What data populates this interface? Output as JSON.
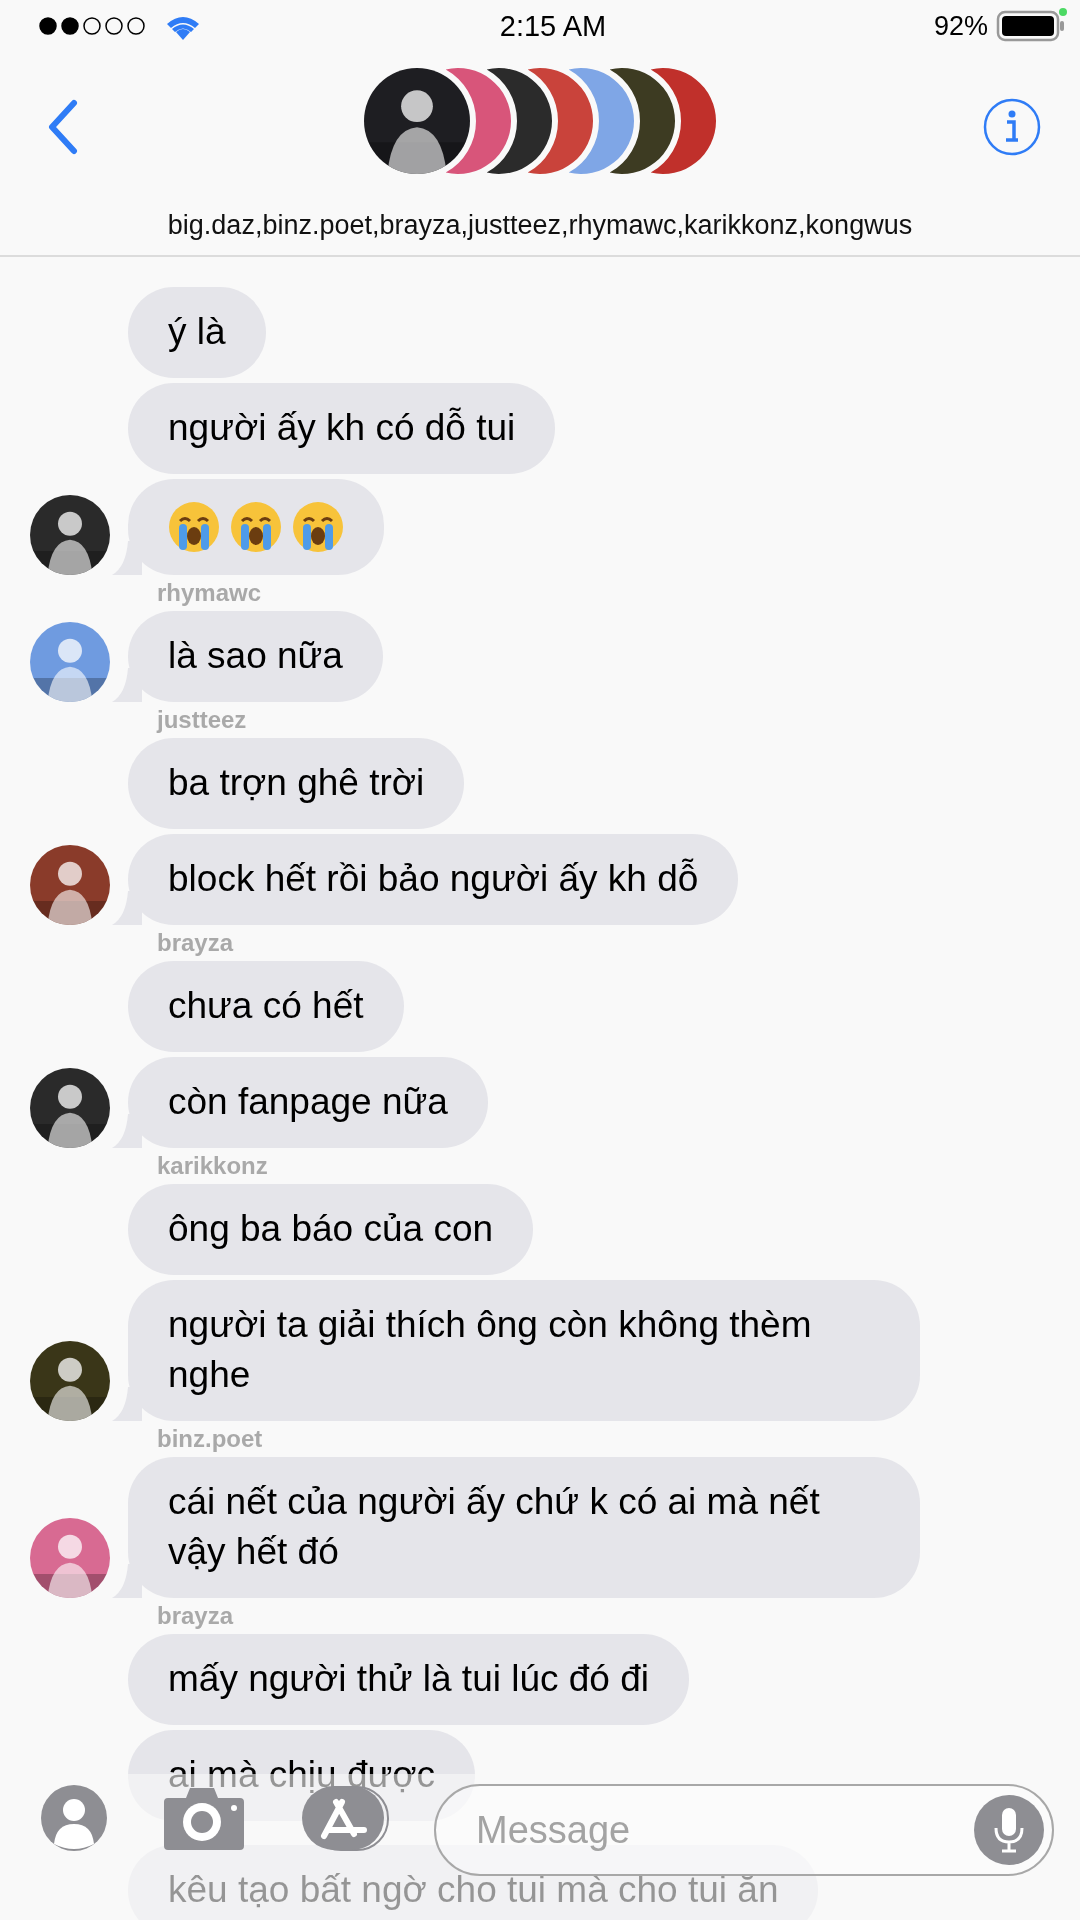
{
  "status_bar": {
    "time": "2:15 AM",
    "battery": "92%"
  },
  "header": {
    "avatars": [
      {
        "color": "#1e1e22"
      },
      {
        "color": "#d8557a"
      },
      {
        "color": "#2b2b2b"
      },
      {
        "color": "#c9433b"
      },
      {
        "color": "#7fa6e6"
      },
      {
        "color": "#3d3b22"
      },
      {
        "color": "#c0302b"
      }
    ],
    "names": "big.daz,binz.poet,brayza,justteez,rhymawc,karikkonz,kongwus"
  },
  "groups": [
    {
      "avatar": {
        "color": "#2a2a2a"
      },
      "messages": [
        {
          "kind": "text",
          "text": "ý là"
        },
        {
          "kind": "text",
          "text": "người ấy kh có dỗ tui"
        },
        {
          "kind": "emoji",
          "emojis": [
            {
              "kind": "crying"
            },
            {
              "kind": "crying"
            },
            {
              "kind": "crying"
            }
          ]
        }
      ]
    },
    {
      "sender": "rhymawc",
      "avatar": {
        "color": "#6f9be0"
      },
      "messages": [
        {
          "kind": "text",
          "text": "là sao nữa"
        }
      ]
    },
    {
      "sender": "justteez",
      "avatar": {
        "color": "#8a3b2a"
      },
      "messages": [
        {
          "kind": "text",
          "text": "ba trợn ghê trời"
        },
        {
          "kind": "text",
          "text": "block hết rồi bảo người ấy kh dỗ"
        }
      ]
    },
    {
      "sender": "brayza",
      "avatar": {
        "color": "#2a2a2a"
      },
      "messages": [
        {
          "kind": "text",
          "text": "chưa có hết"
        },
        {
          "kind": "text",
          "text": "còn fanpage nữa"
        }
      ]
    },
    {
      "sender": "karikkonz",
      "avatar": {
        "color": "#3a3618"
      },
      "messages": [
        {
          "kind": "text",
          "text": "ông ba báo của con"
        },
        {
          "kind": "text",
          "text": "người ta giải thích ông còn không thèm nghe"
        }
      ]
    },
    {
      "sender": "binz.poet",
      "avatar": {
        "color": "#d86a92"
      },
      "messages": [
        {
          "kind": "text",
          "text": "cái nết của người ấy chứ k có ai mà nết vậy hết đó"
        }
      ]
    },
    {
      "sender": "brayza",
      "messages": [
        {
          "kind": "text",
          "text": "mấy người thử là tui lúc đó đi"
        },
        {
          "kind": "text",
          "text": "ai mà chịu được"
        }
      ]
    },
    {
      "messages": [
        {
          "kind": "text",
          "text": "kêu tạo bất ngờ cho tui mà cho tui ăn"
        }
      ]
    }
  ],
  "composer": {
    "placeholder": "Message"
  }
}
